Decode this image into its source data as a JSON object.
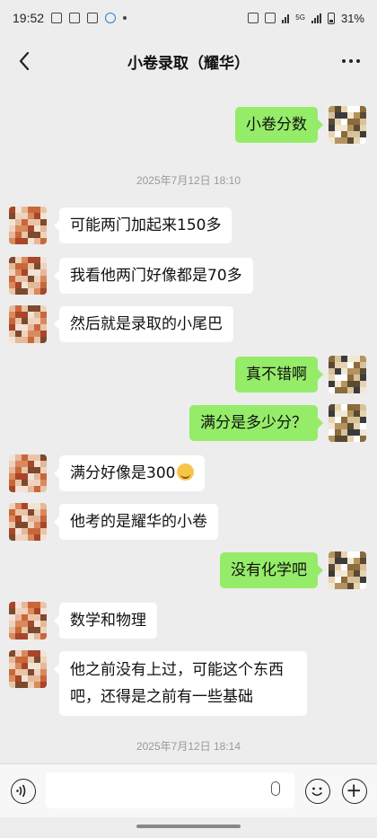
{
  "status_bar": {
    "time": "19:52",
    "network_label": "5G",
    "battery": "31%"
  },
  "header": {
    "title": "小卷录取（耀华）"
  },
  "colors": {
    "my_bubble": "#95ec69",
    "other_bubble": "#ffffff",
    "background": "#ededed"
  },
  "messages": [
    {
      "from": "me",
      "text": "小卷分数"
    },
    {
      "type": "timestamp",
      "text": "2025年7月12日 18:10"
    },
    {
      "from": "other",
      "text": "可能两门加起来150多"
    },
    {
      "from": "other",
      "text": "我看他两门好像都是70多"
    },
    {
      "from": "other",
      "text": "然后就是录取的小尾巴"
    },
    {
      "from": "me",
      "text": "真不错啊"
    },
    {
      "from": "me",
      "text": "满分是多少分？"
    },
    {
      "from": "other",
      "text": "满分好像是300",
      "emoji": "laughing-face-emoji"
    },
    {
      "from": "other",
      "text": "他考的是耀华的小卷"
    },
    {
      "from": "me",
      "text": "没有化学吧"
    },
    {
      "from": "other",
      "text": "数学和物理"
    },
    {
      "from": "other",
      "text": "他之前没有上过，可能这个东西吧，还得是之前有一些基础"
    },
    {
      "type": "timestamp",
      "text": "2025年7月12日 18:14"
    }
  ],
  "input_bar": {
    "placeholder": ""
  },
  "icons": {
    "back": "chevron-left-icon",
    "more": "more-dots-icon",
    "voice": "voice-icon",
    "mic": "mic-icon",
    "emoji": "emoji-icon",
    "plus": "plus-icon"
  }
}
